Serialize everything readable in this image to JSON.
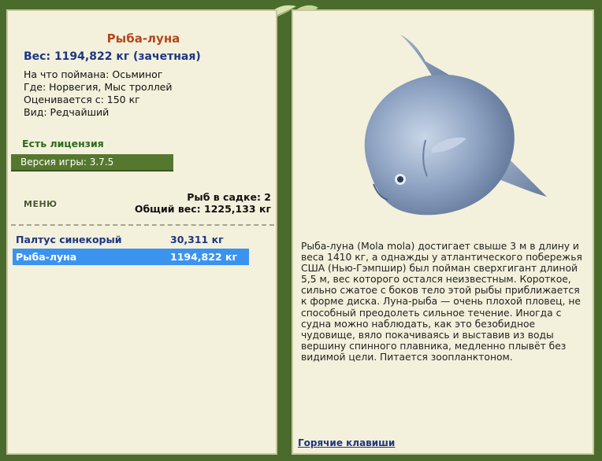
{
  "fish": {
    "name": "Рыба-луна",
    "weight_line": "Вес: 1194,822 кг (зачетная)",
    "caught_on": "На что поймана: Осьминог",
    "location": "Где: Норвегия, Мыс троллей",
    "valued_from": "Оценивается с: 150 кг",
    "kind": "Вид: Редчайший"
  },
  "license": "Есть лицензия",
  "version": "Версия игры: 3.7.5",
  "menu_label": "МЕНЮ",
  "cage": {
    "count": "Рыб в садке: 2",
    "total_weight": "Общий вес: 1225,133 кг"
  },
  "catches": [
    {
      "name": "Палтус синекорый",
      "weight": "30,311 кг",
      "selected": false
    },
    {
      "name": "Рыба-луна",
      "weight": "1194,822 кг",
      "selected": true
    }
  ],
  "description": "Рыба-луна (Mola mola) достигает свыше 3 м в длину и веса 1410 кг, а однажды у атлантического побережья США (Нью-Гэмпшир) был пойман сверхгигант длиной 5,5 м, вес которого остался неизвестным. Короткое, сильно сжатое с боков тело этой рыбы приближается к форме диска. Луна-рыба — очень плохой пловец, не способный преодолеть сильное течение. Иногда с судна можно наблюдать, как это безобидное чудовище, вяло покачиваясь и выставив из воды вершину спинного плавника, медленно плывёт без видимой цели. Питается зоопланктоном.",
  "hotkeys": "Горячие клавиши",
  "colors": {
    "background": "#4a6b2c",
    "panel": "#f3f1dc",
    "title": "#b4471c",
    "link": "#1f3580",
    "selected_row": "#3b93f0"
  }
}
